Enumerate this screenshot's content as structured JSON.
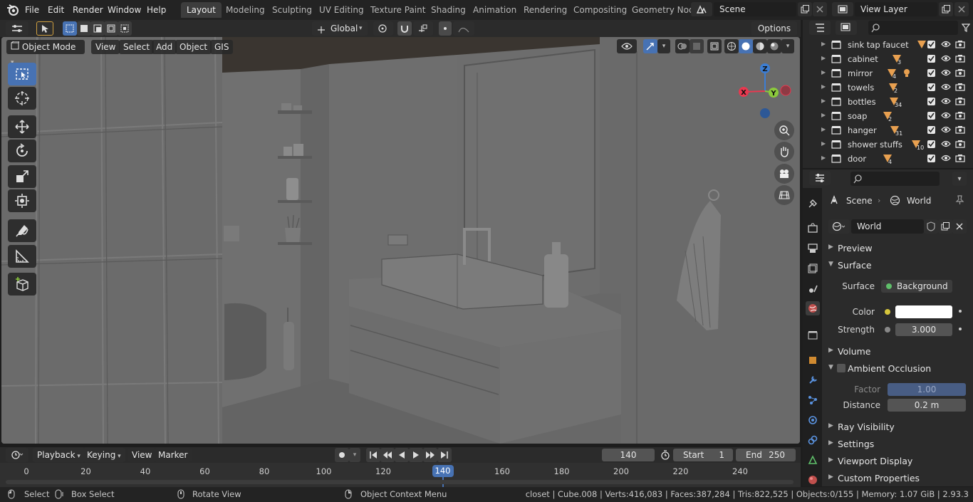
{
  "topbar": {
    "menus": [
      "File",
      "Edit",
      "Render",
      "Window",
      "Help"
    ],
    "workspaces": [
      "Layout",
      "Modeling",
      "Sculpting",
      "UV Editing",
      "Texture Paint",
      "Shading",
      "Animation",
      "Rendering",
      "Compositing",
      "Geometry Nod"
    ],
    "active_workspace": "Layout",
    "scene": "Scene",
    "view_layer": "View Layer"
  },
  "viewport_header": {
    "orientation": "Global",
    "options": "Options",
    "mode": "Object Mode",
    "menus": [
      "View",
      "Select",
      "Add",
      "Object",
      "GIS"
    ]
  },
  "gizmo": {
    "z": "Z",
    "y": "Y",
    "x": "X"
  },
  "outliner": {
    "items": [
      {
        "name": "sink tap faucet",
        "count": ""
      },
      {
        "name": "cabinet",
        "count": "3"
      },
      {
        "name": "mirror",
        "count": "4"
      },
      {
        "name": "towels",
        "count": "2"
      },
      {
        "name": "bottles",
        "count": "34"
      },
      {
        "name": "soap",
        "count": "2"
      },
      {
        "name": "hanger",
        "count": "31"
      },
      {
        "name": "shower stuffs",
        "count": "10"
      },
      {
        "name": "door",
        "count": "4"
      }
    ]
  },
  "properties": {
    "breadcrumb_scene": "Scene",
    "breadcrumb_world": "World",
    "world_name": "World",
    "panels": {
      "preview": "Preview",
      "surface": "Surface",
      "volume": "Volume",
      "ambient_occlusion": "Ambient Occlusion",
      "ray_visibility": "Ray Visibility",
      "settings": "Settings",
      "viewport_display": "Viewport Display",
      "custom_properties": "Custom Properties"
    },
    "surface_label": "Surface",
    "surface_value": "Background",
    "color_label": "Color",
    "color_value": "#ffffff",
    "strength_label": "Strength",
    "strength_value": "3.000",
    "factor_label": "Factor",
    "factor_value": "1.00",
    "distance_label": "Distance",
    "distance_value": "0.2 m"
  },
  "timeline": {
    "menus": [
      "Playback",
      "Keying",
      "View",
      "Marker"
    ],
    "current_frame": "140",
    "start_label": "Start",
    "start": "1",
    "end_label": "End",
    "end": "250",
    "ticks": [
      "0",
      "20",
      "40",
      "60",
      "80",
      "100",
      "120",
      "140",
      "160",
      "180",
      "200",
      "220",
      "240"
    ]
  },
  "statusbar": {
    "select": "Select",
    "box_select": "Box Select",
    "rotate_view": "Rotate View",
    "context_menu": "Object Context Menu",
    "stats": "closet | Cube.008 | Verts:416,083 | Faces:387,284 | Tris:822,525 | Objects:0/155 | Memory: 1.07 GiB | 2.93.3"
  },
  "colors": {
    "accent": "#4772b3",
    "axis_x": "#e8384f",
    "axis_y": "#8bc93c",
    "axis_z": "#3c7ed4"
  }
}
